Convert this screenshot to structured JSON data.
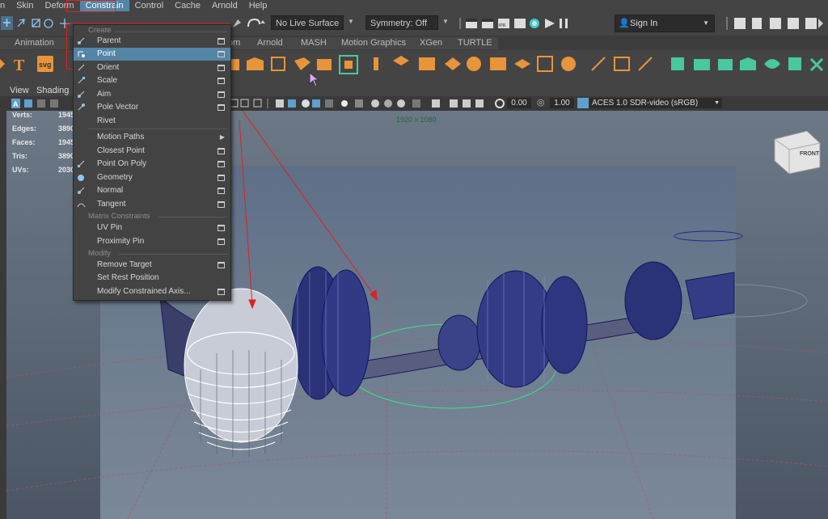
{
  "menubar": {
    "items": [
      {
        "label": "n",
        "active": false
      },
      {
        "label": "Skin",
        "active": false
      },
      {
        "label": "Deform",
        "active": false
      },
      {
        "label": "Constrain",
        "active": true
      },
      {
        "label": "Control",
        "active": false
      },
      {
        "label": "Cache",
        "active": false
      },
      {
        "label": "Arnold",
        "active": false
      },
      {
        "label": "Help",
        "active": false
      }
    ]
  },
  "statusline": {
    "live_surface": "No Live Surface",
    "symmetry": "Symmetry: Off",
    "sign_in": "Sign In"
  },
  "shelf_tabs": [
    "Animation",
    "om",
    "Arnold",
    "MASH",
    "Motion Graphics",
    "XGen",
    "TURTLE"
  ],
  "panel_menu": {
    "view": "View",
    "shading": "Shading"
  },
  "panel_toolbar": {
    "value1": "0.00",
    "value2": "1.00",
    "color_space": "ACES 1.0 SDR-video (sRGB)"
  },
  "viewport": {
    "resolution": "1920 x 1080",
    "cube_label": "FRONT",
    "hud": [
      {
        "label": "Verts:",
        "value": "1945"
      },
      {
        "label": "Edges:",
        "value": "3890"
      },
      {
        "label": "Faces:",
        "value": "1945"
      },
      {
        "label": "Tris:",
        "value": "3890"
      },
      {
        "label": "UVs:",
        "value": "2030"
      }
    ]
  },
  "constrain_menu": {
    "header_create": "Create",
    "header_matrix": "Matrix Constraints",
    "header_modify": "Modify",
    "items": {
      "parent": "Parent",
      "point": "Point",
      "orient": "Orient",
      "scale": "Scale",
      "aim": "Aim",
      "pole_vector": "Pole Vector",
      "rivet": "Rivet",
      "motion_paths": "Motion Paths",
      "closest_point": "Closest Point",
      "point_on_poly": "Point On Poly",
      "geometry": "Geometry",
      "normal": "Normal",
      "tangent": "Tangent",
      "uv_pin": "UV Pin",
      "proximity_pin": "Proximity Pin",
      "remove_target": "Remove Target",
      "set_rest_position": "Set Rest Position",
      "modify_constrained_axis": "Modify Constrained Axis..."
    },
    "highlighted": "Point"
  },
  "colors": {
    "accent": "#5285a6",
    "annotation": "#e02020",
    "shelf_orange": "#e8943a",
    "shelf_green": "#48c8a0"
  }
}
